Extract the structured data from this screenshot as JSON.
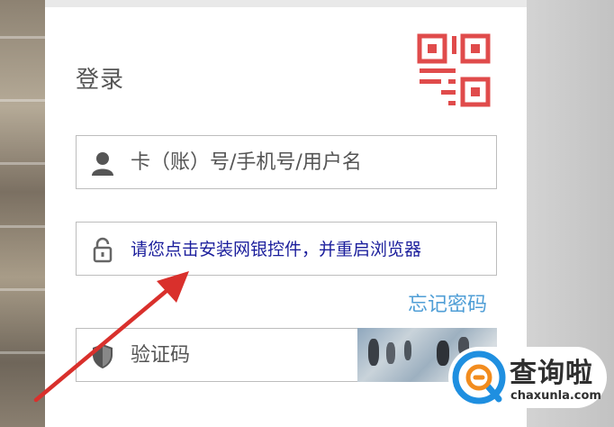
{
  "login": {
    "title": "登录",
    "username_placeholder": "卡（账）号/手机号/用户名",
    "password_notice": "请您点击安装网银控件，并重启浏览器",
    "forgot_password": "忘记密码",
    "captcha_placeholder": "验证码"
  },
  "watermark": {
    "brand": "查询啦",
    "url": "chaxunla.com"
  },
  "colors": {
    "accent_red": "#e04b4b",
    "link_blue": "#4f9ed6",
    "notice_blue": "#1b1e9c",
    "watermark_blue": "#1f8fe0"
  },
  "icons": [
    "qr-code-icon",
    "user-icon",
    "lock-icon",
    "shield-icon",
    "annotation-arrow"
  ]
}
